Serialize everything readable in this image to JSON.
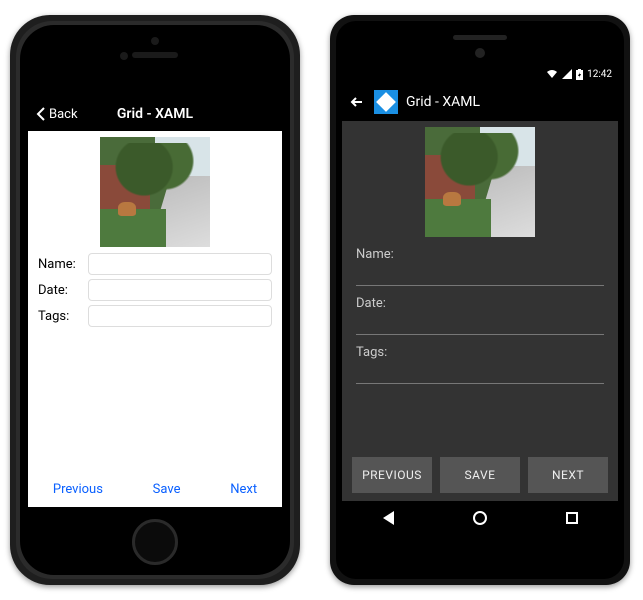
{
  "ios": {
    "back_label": "Back",
    "title": "Grid - XAML",
    "fields": {
      "name_label": "Name:",
      "date_label": "Date:",
      "tags_label": "Tags:",
      "name_value": "",
      "date_value": "",
      "tags_value": ""
    },
    "buttons": {
      "previous": "Previous",
      "save": "Save",
      "next": "Next"
    }
  },
  "android": {
    "status_time": "12:42",
    "title": "Grid - XAML",
    "fields": {
      "name_label": "Name:",
      "date_label": "Date:",
      "tags_label": "Tags:",
      "name_value": "",
      "date_value": "",
      "tags_value": ""
    },
    "buttons": {
      "previous": "PREVIOUS",
      "save": "SAVE",
      "next": "NEXT"
    }
  }
}
